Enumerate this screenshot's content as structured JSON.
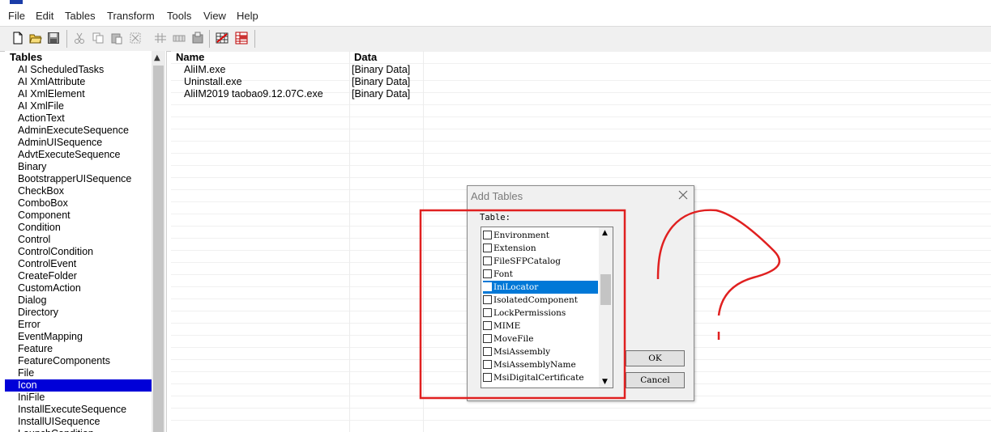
{
  "menu": [
    "File",
    "Edit",
    "Tables",
    "Transform",
    "Tools",
    "View",
    "Help"
  ],
  "toolbar_icons": [
    "new-icon",
    "open-icon",
    "save-icon",
    "cut-icon",
    "copy-icon",
    "paste-icon",
    "delete-icon",
    "add-row-icon",
    "drop-table-icon",
    "export-icon",
    "validate-icon",
    "table-view-icon"
  ],
  "tables_pane": {
    "header": "Tables",
    "items": [
      "AI ScheduledTasks",
      "AI XmlAttribute",
      "AI XmlElement",
      "AI XmlFile",
      "ActionText",
      "AdminExecuteSequence",
      "AdminUISequence",
      "AdvtExecuteSequence",
      "Binary",
      "BootstrapperUISequence",
      "CheckBox",
      "ComboBox",
      "Component",
      "Condition",
      "Control",
      "ControlCondition",
      "ControlEvent",
      "CreateFolder",
      "CustomAction",
      "Dialog",
      "Directory",
      "Error",
      "EventMapping",
      "Feature",
      "FeatureComponents",
      "File",
      "Icon",
      "IniFile",
      "InstallExecuteSequence",
      "InstallUISequence",
      "LaunchCondition"
    ],
    "selected": "Icon"
  },
  "grid": {
    "columns": [
      "Name",
      "Data"
    ],
    "rows": [
      [
        "AliIM.exe",
        "[Binary Data]"
      ],
      [
        "Uninstall.exe",
        "[Binary Data]"
      ],
      [
        "AliIM2019 taobao9.12.07C.exe",
        "[Binary Data]"
      ]
    ]
  },
  "dialog": {
    "title": "Add Tables",
    "label": "Table:",
    "items": [
      "Environment",
      "Extension",
      "FileSFPCatalog",
      "Font",
      "IniLocator",
      "IsolatedComponent",
      "LockPermissions",
      "MIME",
      "MoveFile",
      "MsiAssembly",
      "MsiAssemblyName",
      "MsiDigitalCertificate"
    ],
    "selected": "IniLocator",
    "ok": "OK",
    "cancel": "Cancel"
  },
  "colors": {
    "selection_left": "#0000d8",
    "selection_dialog": "#0078d7",
    "annotation": "#e02020"
  }
}
